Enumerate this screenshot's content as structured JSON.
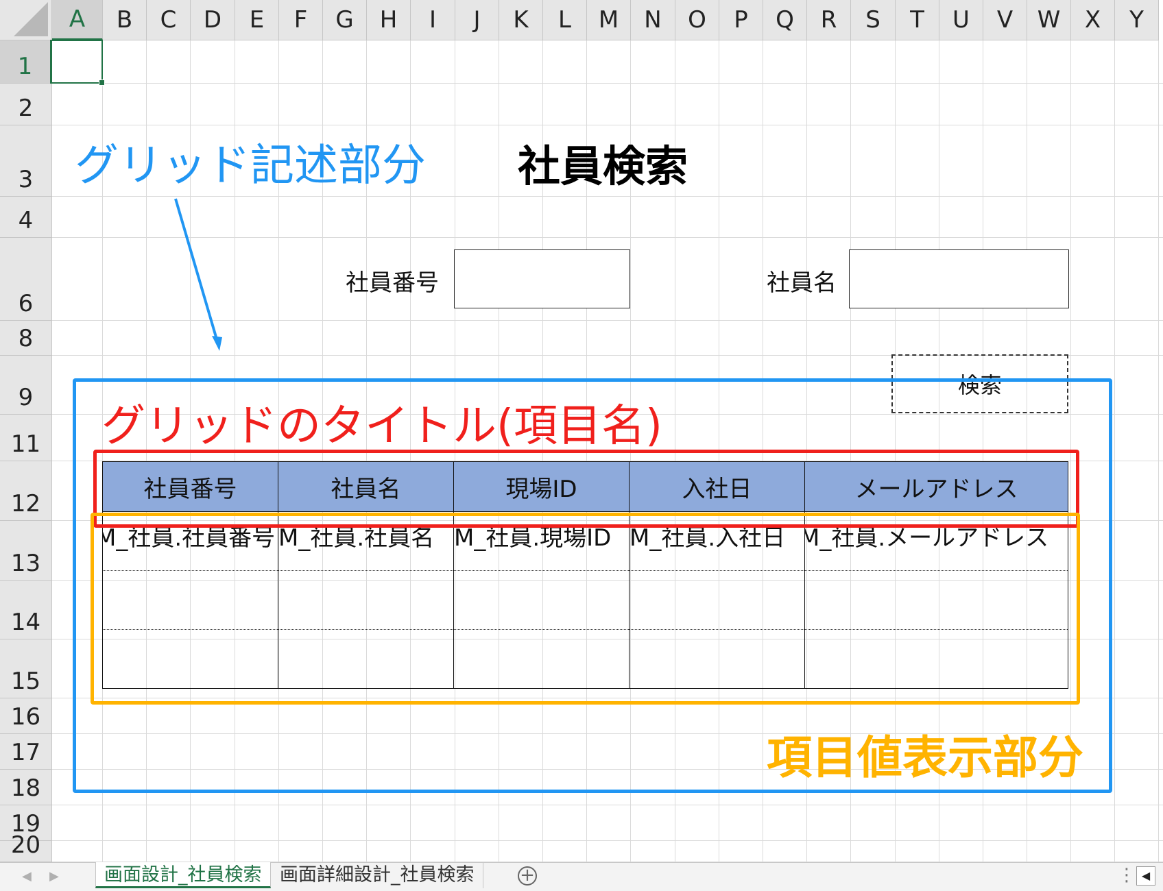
{
  "spreadsheet": {
    "column_headers": [
      "A",
      "B",
      "C",
      "D",
      "E",
      "F",
      "G",
      "H",
      "I",
      "J",
      "K",
      "L",
      "M",
      "N",
      "O",
      "P",
      "Q",
      "R",
      "S",
      "T",
      "U",
      "V",
      "W",
      "X",
      "Y"
    ],
    "row_headers": [
      "1",
      "2",
      "3",
      "4",
      "6",
      "8",
      "9",
      "11",
      "12",
      "13",
      "14",
      "15",
      "16",
      "17",
      "18",
      "19",
      "20"
    ],
    "selected_cell": "A1"
  },
  "form": {
    "title": "社員検索",
    "employee_number_label": "社員番号",
    "employee_name_label": "社員名",
    "search_button_label": "検索"
  },
  "results_grid": {
    "headers": [
      "社員番号",
      "社員名",
      "現場ID",
      "入社日",
      "メールアドレス"
    ],
    "rows": [
      [
        "M_社員.社員番号",
        "M_社員.社員名",
        "M_社員.現場ID",
        "M_社員.入社日",
        "M_社員.メールアドレス"
      ],
      [
        "",
        "",
        "",
        "",
        ""
      ],
      [
        "",
        "",
        "",
        "",
        ""
      ]
    ]
  },
  "annotations": {
    "grid_section_label": "グリッド記述部分",
    "grid_title_label": "グリッドのタイトル(項目名)",
    "value_display_label": "項目値表示部分",
    "colors": {
      "blue": "#2196F3",
      "red": "#F0201C",
      "yellow": "#FFB300"
    }
  },
  "sheet_tabs": {
    "active": "画面設計_社員検索",
    "inactive": "画面詳細設計_社員検索",
    "add_icon": "plus-circle-icon"
  }
}
